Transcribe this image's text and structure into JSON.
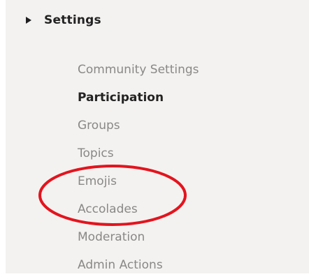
{
  "section": {
    "title": "Settings",
    "caret_icon": "caret-right-icon"
  },
  "nav": {
    "items": [
      {
        "label": "Community Settings",
        "active": false
      },
      {
        "label": "Participation",
        "active": true
      },
      {
        "label": "Groups",
        "active": false
      },
      {
        "label": "Topics",
        "active": false
      },
      {
        "label": "Emojis",
        "active": false
      },
      {
        "label": "Accolades",
        "active": false
      },
      {
        "label": "Moderation",
        "active": false
      },
      {
        "label": "Admin Actions",
        "active": false
      }
    ]
  },
  "annotation": {
    "shape": "ellipse",
    "color": "#e3141e"
  },
  "colors": {
    "panel_bg": "#f4f2f0",
    "text_muted": "#8a8886",
    "text_active": "#232323"
  }
}
